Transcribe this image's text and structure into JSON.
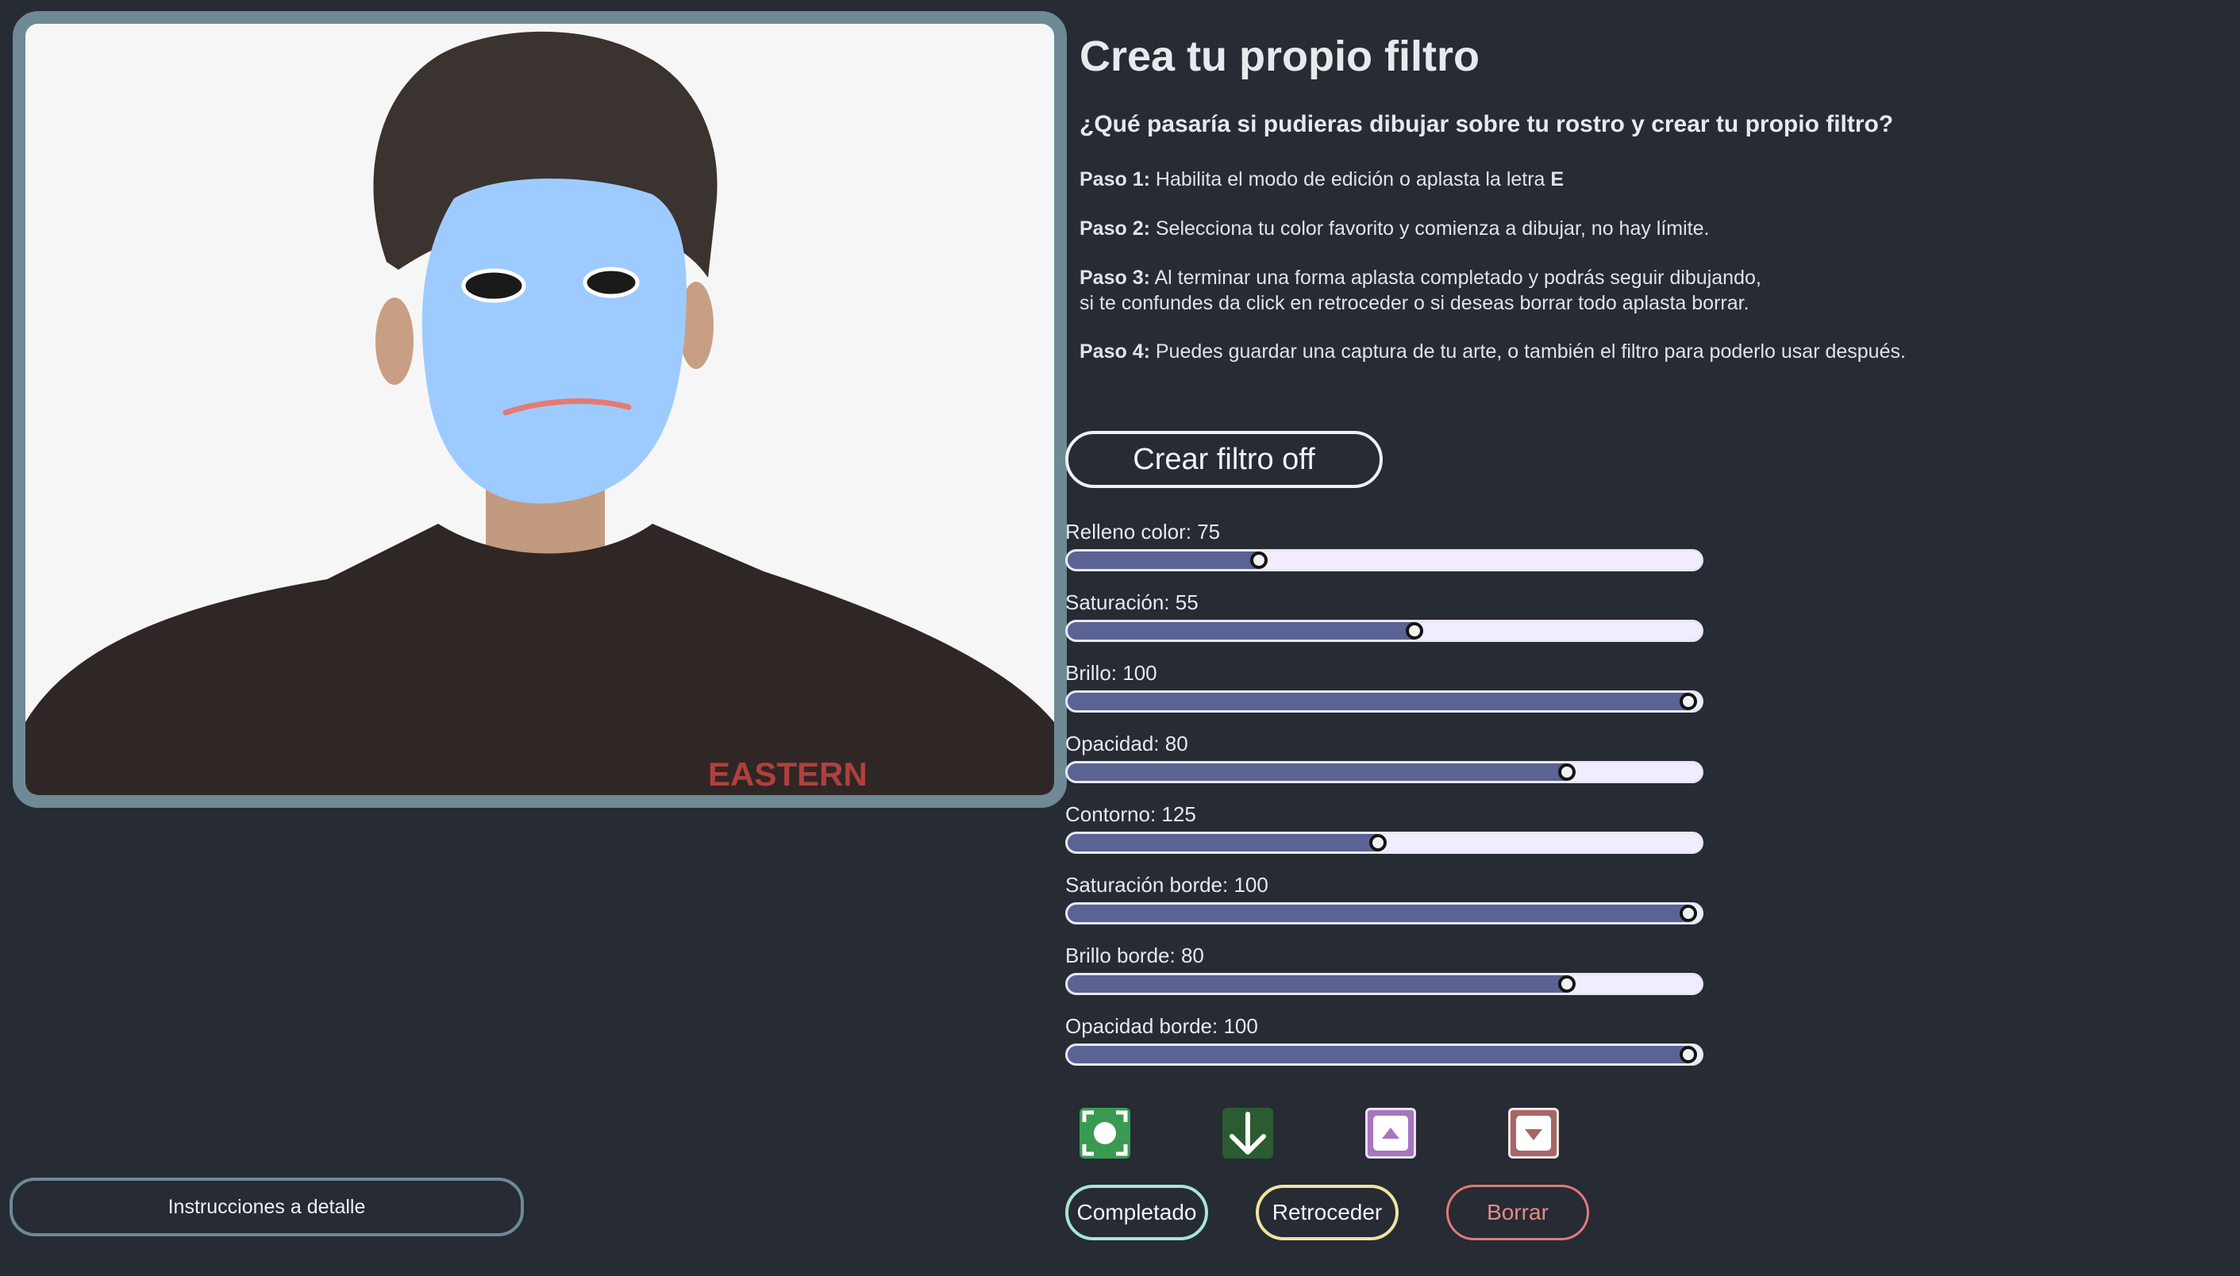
{
  "camera": {
    "shirt_text": "EASTERN"
  },
  "header": {
    "title": "Crea tu propio filtro",
    "question": "¿Qué pasaría si pudieras dibujar sobre tu rostro y crear tu propio filtro?"
  },
  "steps": [
    {
      "label": "Paso 1:",
      "text": " Habilita el modo de edición o aplasta la letra ",
      "key": "E"
    },
    {
      "label": "Paso 2:",
      "text": " Selecciona tu color favorito y comienza a dibujar, no hay límite."
    },
    {
      "label": "Paso 3:",
      "text": " Al terminar una forma aplasta completado y podrás seguir dibujando,",
      "text2": "si te confundes da click en retroceder o si deseas borrar todo aplasta borrar."
    },
    {
      "label": "Paso 4:",
      "text": " Puedes guardar una captura de tu arte, o también el filtro para poderlo usar después."
    }
  ],
  "toggle_button": "Crear filtro off",
  "sliders": [
    {
      "label": "Relleno color: 75",
      "value": 75,
      "min": 0,
      "max": 255
    },
    {
      "label": "Saturación: 55",
      "value": 55,
      "min": 0,
      "max": 100
    },
    {
      "label": "Brillo: 100",
      "value": 100,
      "min": 0,
      "max": 100
    },
    {
      "label": "Opacidad: 80",
      "value": 80,
      "min": 0,
      "max": 100
    },
    {
      "label": "Contorno: 125",
      "value": 125,
      "min": 0,
      "max": 255
    },
    {
      "label": "Saturación borde: 100",
      "value": 100,
      "min": 0,
      "max": 100
    },
    {
      "label": "Brillo borde: 80",
      "value": 80,
      "min": 0,
      "max": 100
    },
    {
      "label": "Opacidad borde: 100",
      "value": 100,
      "min": 0,
      "max": 100
    }
  ],
  "icons": [
    "capture-icon",
    "download-icon",
    "upload-icon",
    "import-icon"
  ],
  "actions": {
    "completado": "Completado",
    "retroceder": "Retroceder",
    "borrar": "Borrar"
  },
  "instructions_button": "Instrucciones a detalle",
  "colors": {
    "background": "#262b34",
    "frame": "#6d8a95",
    "mask": "#9ecbff",
    "slider_fill": "#5b6294"
  }
}
